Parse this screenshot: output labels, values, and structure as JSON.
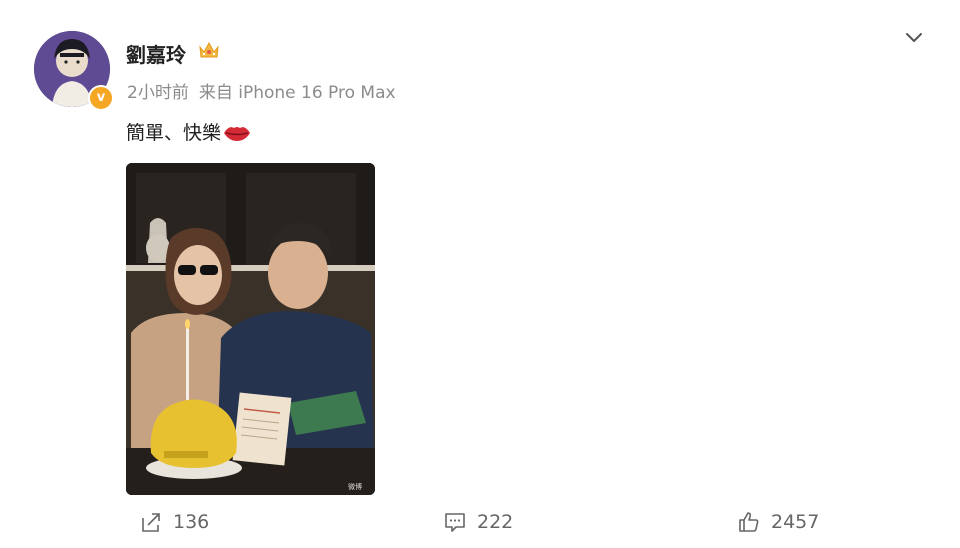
{
  "post": {
    "username": "劉嘉玲",
    "time": "2小时前",
    "source": "来自 iPhone 16 Pro Max",
    "text": "簡單、快樂",
    "verified_mark": "v"
  },
  "actions": {
    "share_count": "136",
    "comment_count": "222",
    "like_count": "2457"
  },
  "icons": {
    "crown": "crown-icon",
    "lips": "lips-emoji-icon",
    "menu": "chevron-down-icon",
    "share": "share-icon",
    "comment": "comment-icon",
    "like": "thumbs-up-icon"
  },
  "colors": {
    "verified": "#f5a623",
    "meta_text": "#8b8b8b",
    "action_text": "#666666"
  }
}
